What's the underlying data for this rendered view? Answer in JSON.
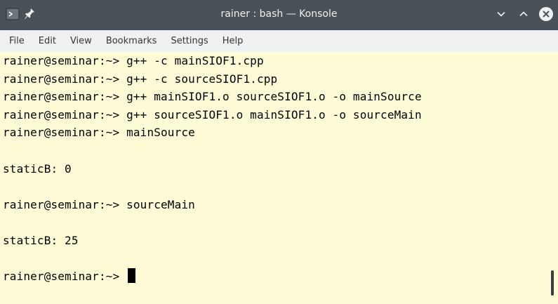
{
  "window": {
    "title": "rainer : bash — Konsole"
  },
  "titlebar": {
    "icons": {
      "app": "terminal-app-icon",
      "pin": "pin-icon",
      "minimize": "chevron-down-icon",
      "maximize": "chevron-up-icon",
      "close": "close-icon"
    }
  },
  "menubar": {
    "items": [
      "File",
      "Edit",
      "View",
      "Bookmarks",
      "Settings",
      "Help"
    ]
  },
  "terminal": {
    "lines": [
      "rainer@seminar:~> g++ -c mainSIOF1.cpp",
      "rainer@seminar:~> g++ -c sourceSIOF1.cpp",
      "rainer@seminar:~> g++ mainSIOF1.o sourceSIOF1.o -o mainSource",
      "rainer@seminar:~> g++ sourceSIOF1.o mainSIOF1.o -o sourceMain",
      "rainer@seminar:~> mainSource",
      "",
      "staticB: 0",
      "",
      "rainer@seminar:~> sourceMain",
      "",
      "staticB: 25",
      "",
      "rainer@seminar:~> "
    ]
  },
  "colors": {
    "titlebar_bg": "#4a5259",
    "menubar_bg": "#eff0f1",
    "terminal_bg": "#fdfcd6",
    "terminal_fg": "#000000",
    "close_button": "#eff0f1"
  }
}
